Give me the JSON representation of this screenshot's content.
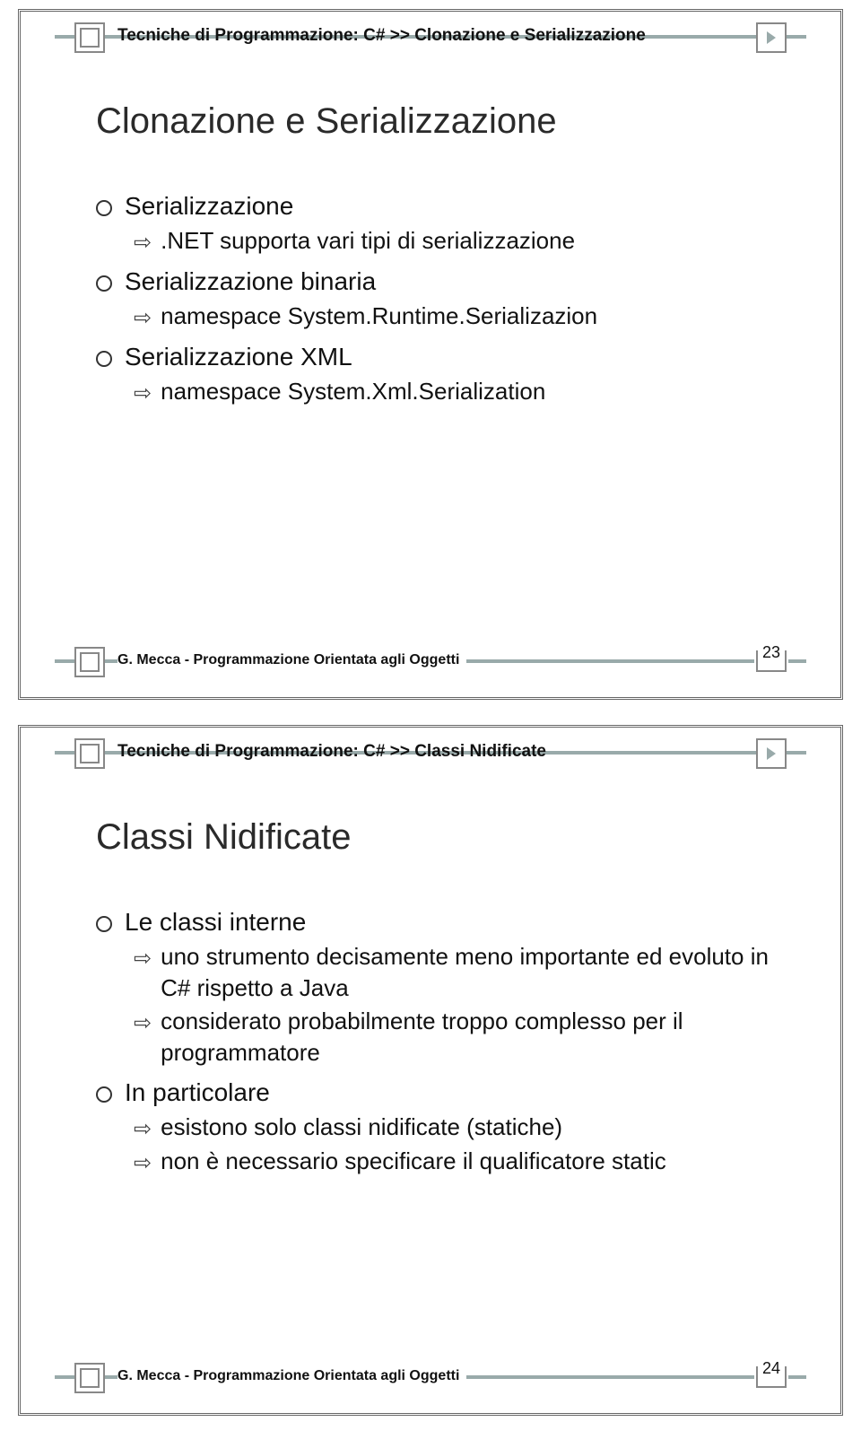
{
  "footer_author": "G. Mecca - Programmazione Orientata agli Oggetti",
  "slide1": {
    "header": "Tecniche di Programmazione: C# >> Clonazione e Serializzazione",
    "title": "Clonazione e Serializzazione",
    "b1": "Serializzazione",
    "b1_1": ".NET supporta vari tipi di serializzazione",
    "b2": "Serializzazione binaria",
    "b2_1": "namespace System.Runtime.Serializazion",
    "b3": "Serializzazione XML",
    "b3_1": "namespace System.Xml.Serialization",
    "page": "23"
  },
  "slide2": {
    "header": "Tecniche di Programmazione: C# >> Classi Nidificate",
    "title": "Classi Nidificate",
    "b1": "Le classi interne",
    "b1_1": "uno strumento decisamente meno importante ed evoluto in C# rispetto a Java",
    "b1_2": "considerato probabilmente troppo complesso per il programmatore",
    "b2": "In particolare",
    "b2_1": "esistono solo classi nidificate (statiche)",
    "b2_2": "non è necessario specificare il qualificatore static",
    "page": "24"
  }
}
